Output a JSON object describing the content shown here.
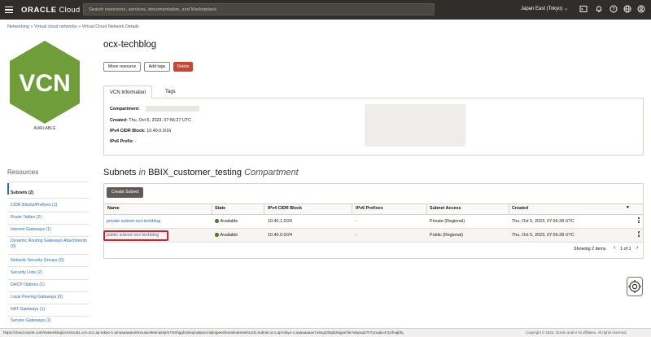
{
  "topbar": {
    "logo_bold": "ORACLE",
    "logo_rest": " Cloud",
    "search_placeholder": "Search resources, services, documentation, and Marketplace",
    "region": "Japan East (Tokyo)",
    "icons": [
      "menu-icon",
      "chevron-down-icon",
      "cloud-shell-icon",
      "bell-icon",
      "help-icon",
      "globe-icon",
      "user-icon"
    ]
  },
  "breadcrumb": {
    "items": [
      "Networking",
      "Virtual cloud networks",
      "Virtual Cloud Network Details"
    ],
    "separator": " » "
  },
  "vcn": {
    "badge_text": "VCN",
    "badge_color": "#6f9d3a",
    "status": "AVAILABLE"
  },
  "resources": {
    "title": "Resources",
    "items": [
      {
        "label": "Subnets (2)",
        "active": true
      },
      {
        "label": "CIDR Blocks/Prefixes (1)",
        "active": false
      },
      {
        "label": "Route Tables (2)",
        "active": false
      },
      {
        "label": "Internet Gateways (1)",
        "active": false
      },
      {
        "label": "Dynamic Routing Gateways Attachments (0)",
        "active": false
      },
      {
        "label": "Network Security Groups (0)",
        "active": false
      },
      {
        "label": "Security Lists (2)",
        "active": false
      },
      {
        "label": "DHCP Options (1)",
        "active": false
      },
      {
        "label": "Local Peering Gateways (0)",
        "active": false
      },
      {
        "label": "NAT Gateways (1)",
        "active": false
      },
      {
        "label": "Service Gateways (1)",
        "active": false
      }
    ]
  },
  "page": {
    "title": "ocx-techblog",
    "buttons": {
      "move": "Move resource",
      "add_tags": "Add tags",
      "delete": "Delete"
    },
    "tabs": [
      "VCN Information",
      "Tags"
    ]
  },
  "info": {
    "compartment_label": "Compartment:",
    "created_label": "Created:",
    "created_value": "Thu, Oct 5, 2023, 07:56:27 UTC",
    "ipv4_label": "IPv4 CIDR Block:",
    "ipv4_value": "10.40.0.0/16",
    "ipv6_label": "IPv6 Prefix:",
    "ipv6_value": "-"
  },
  "subnets": {
    "title_main": "Subnets",
    "title_in": "in",
    "title_compartment": "BBIX_customer_testing",
    "title_suffix": "Compartment",
    "create_button": "Create Subnet",
    "columns": [
      "Name",
      "State",
      "IPv4 CIDR Block",
      "IPv6 Prefixes",
      "Subnet Access",
      "Created"
    ],
    "rows": [
      {
        "name": "private subnet-ocx-techblog",
        "state": "Available",
        "ipv4": "10.40.1.0/24",
        "ipv6": "-",
        "access": "Private (Regional)",
        "created": "Thu, Oct 5, 2023, 07:56:28 UTC"
      },
      {
        "name": "public subnet-ocx-techblog",
        "state": "Available",
        "ipv4": "10.40.0.0/24",
        "ipv6": "-",
        "access": "Public (Regional)",
        "created": "Thu, Oct 5, 2023, 07:56:28 UTC"
      }
    ],
    "showing": "Showing 2 items",
    "pager_prev": "‹",
    "pager_page": "1 of 1",
    "pager_next": "›",
    "status_color": "#4f7e25"
  },
  "statusbar": {
    "url": "https://cloud.oracle.com/networking/vcns/ocid1.vcn.oc1.ap-tokyo-1.amaaaaaaru5mouiacek6massjrm73mhgqh2xkojzu8paccmjknjpeezbmia/subnets/ocid1.subnet.oc1.ap-tokyo-1.aaaaaaaax7u6vg335pfpr6qjoicfte7akywq37h7yzuqku47y2fnajbfq",
    "copyright": "Copyright © 2023, Oracle and/or its affiliates. All rights reserved."
  }
}
